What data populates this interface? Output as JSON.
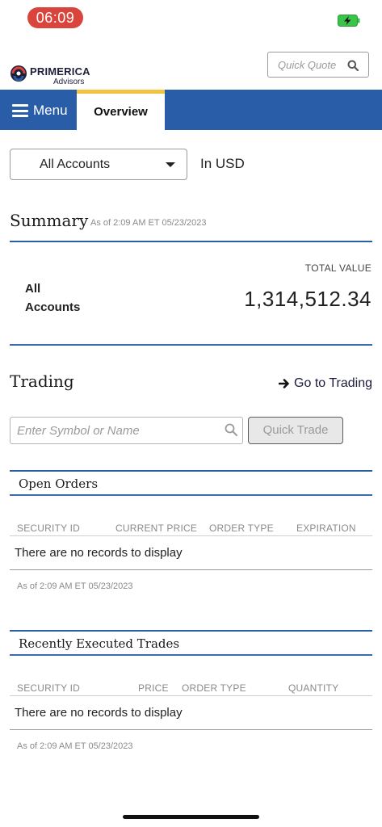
{
  "status_bar": {
    "time": "06:09"
  },
  "header": {
    "logo_brand": "PRIMERICA",
    "logo_sub": "Advisors",
    "quick_quote_placeholder": "Quick Quote"
  },
  "nav": {
    "menu_label": "Menu",
    "active_tab": "Overview"
  },
  "accounts": {
    "selected": "All Accounts",
    "currency": "In USD"
  },
  "summary": {
    "title": "Summary",
    "as_of": "As of 2:09 AM ET 05/23/2023",
    "total_value_label": "TOTAL VALUE",
    "account_name": "All Accounts",
    "total_value": "1,314,512.34"
  },
  "trading": {
    "title": "Trading",
    "go_to_link": "Go to Trading",
    "symbol_placeholder": "Enter Symbol or Name",
    "quick_trade_label": "Quick Trade"
  },
  "open_orders": {
    "title": "Open Orders",
    "columns": [
      "SECURITY ID",
      "CURRENT PRICE",
      "ORDER TYPE",
      "EXPIRATION"
    ],
    "empty_message": "There are no records to display",
    "as_of": "As of 2:09 AM ET 05/23/2023"
  },
  "recent_trades": {
    "title": "Recently Executed Trades",
    "columns": [
      "SECURITY ID",
      "PRICE",
      "ORDER TYPE",
      "QUANTITY"
    ],
    "empty_message": "There are no records to display",
    "as_of": "As of 2:09 AM ET 05/23/2023"
  },
  "colors": {
    "nav_blue": "#2a5da8",
    "tab_accent": "#f2c341",
    "status_time_bg": "#d9453c",
    "battery_green": "#3cc44a"
  },
  "icons": {
    "battery": "battery-charging-icon",
    "quick_quote": "search-icon",
    "menu": "hamburger-icon",
    "dropdown": "caret-down-icon",
    "go_to_trading": "arrow-right-icon",
    "symbol_search": "search-icon"
  }
}
